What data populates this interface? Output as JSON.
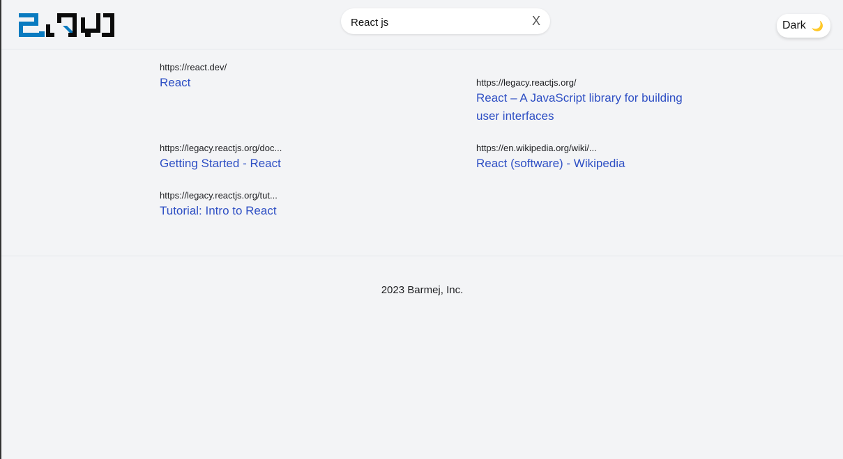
{
  "header": {
    "search": {
      "value": "React js",
      "clear_label": "X"
    },
    "theme_toggle": {
      "label": "Dark",
      "icon": "moon-icon"
    },
    "logo_colors": {
      "blue": "#0a7bc0",
      "black": "#0b0b0b"
    }
  },
  "results": [
    {
      "url": "https://react.dev/",
      "title": "React"
    },
    {
      "url": "https://legacy.reactjs.org/",
      "title": "React – A JavaScript library for building user interfaces"
    },
    {
      "url": "https://legacy.reactjs.org/doc...",
      "title": "Getting Started - React"
    },
    {
      "url": "https://en.wikipedia.org/wiki/...",
      "title": "React (software) - Wikipedia"
    },
    {
      "url": "https://legacy.reactjs.org/tut...",
      "title": "Tutorial: Intro to React"
    }
  ],
  "footer": {
    "text": "2023 Barmej, Inc."
  },
  "colors": {
    "link": "#2e4fc4",
    "background": "#f3f4f6"
  }
}
